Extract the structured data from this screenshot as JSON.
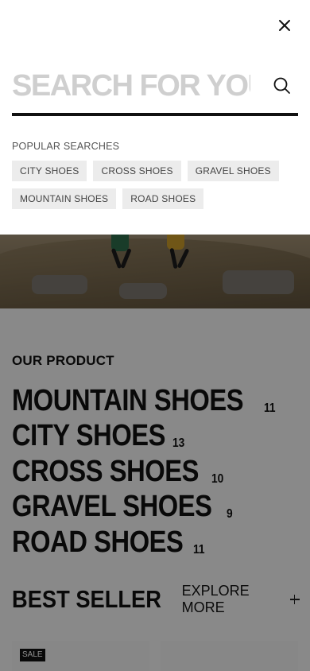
{
  "search": {
    "placeholder": "SEARCH FOR YOUR THING",
    "popular_label": "POPULAR SEARCHES",
    "popular_chips": [
      "CITY SHOES",
      "CROSS SHOES",
      "GRAVEL SHOES",
      "MOUNTAIN SHOES",
      "ROAD SHOES"
    ]
  },
  "product_section": {
    "eyebrow": "OUR PRODUCT",
    "categories": [
      {
        "name": "MOUNTAIN SHOES",
        "count": "11"
      },
      {
        "name": "CITY SHOES",
        "count": "13"
      },
      {
        "name": "CROSS SHOES",
        "count": "10"
      },
      {
        "name": "GRAVEL SHOES",
        "count": "9"
      },
      {
        "name": "ROAD SHOES",
        "count": "11"
      }
    ]
  },
  "best_seller": {
    "title": "BEST SELLER",
    "explore_label": "EXPLORE MORE",
    "badge": "SALE"
  },
  "icons": {
    "close": "close-icon",
    "search": "search-icon",
    "plus": "plus-icon"
  },
  "colors": {
    "text": "#111111",
    "chip_bg": "#ececec",
    "overlay": "rgba(0,0,0,0.44)"
  }
}
